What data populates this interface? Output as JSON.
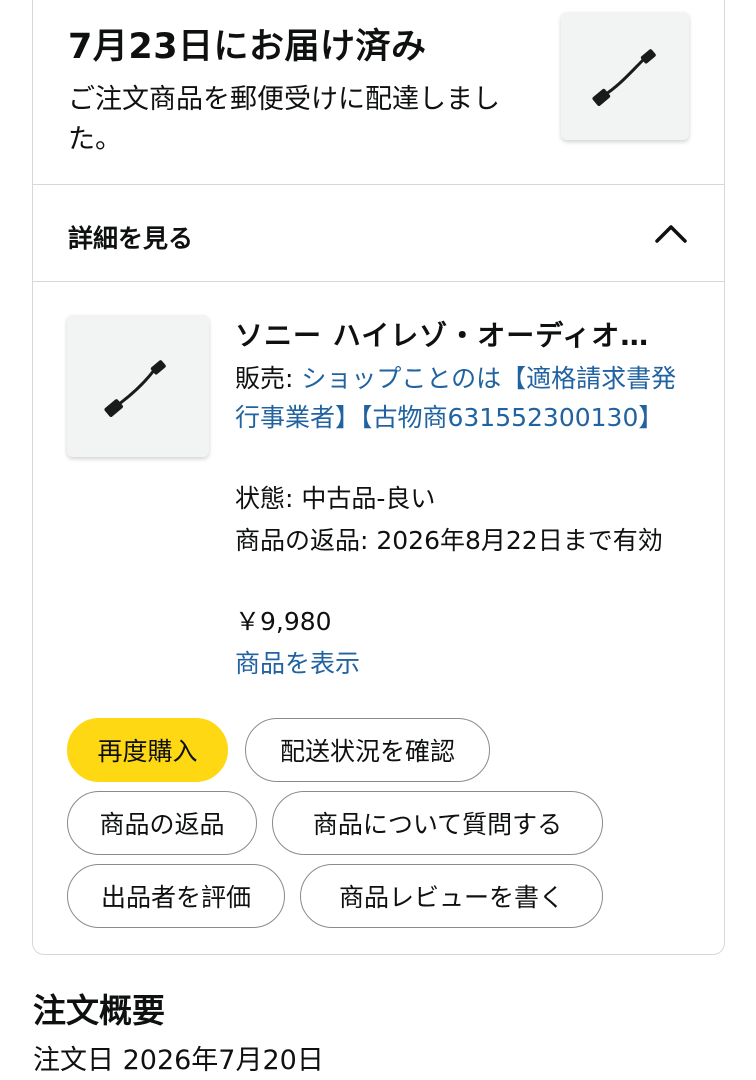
{
  "delivery": {
    "title": "7月23日にお届け済み",
    "message": "ご注文商品を郵便受けに配達しました。"
  },
  "details": {
    "label": "詳細を見る",
    "icon": "chevron-up-icon"
  },
  "item": {
    "title": "ソニー ハイレゾ・オーディオ",
    "seller_prefix": "販売: ",
    "seller_name": "ショップことのは【適格請求書発行事業者】【古物商631552300130】",
    "condition": "状態: 中古品-良い",
    "return_policy": "商品の返品: 2026年8月22日まで有効",
    "price": "￥9,980",
    "view_link": "商品を表示",
    "image_icon": "usb-cable-icon"
  },
  "actions": {
    "buy_again": "再度購入",
    "track_package": "配送状況を確認",
    "return_item": "商品の返品",
    "ask_question": "商品について質問する",
    "rate_seller": "出品者を評価",
    "write_review": "商品レビューを書く"
  },
  "summary": {
    "title": "注文概要",
    "order_date": "注文日 2026年7月20日"
  },
  "colors": {
    "primary_button": "#ffd814",
    "link": "#2162a1",
    "border": "#d5d9d9"
  }
}
